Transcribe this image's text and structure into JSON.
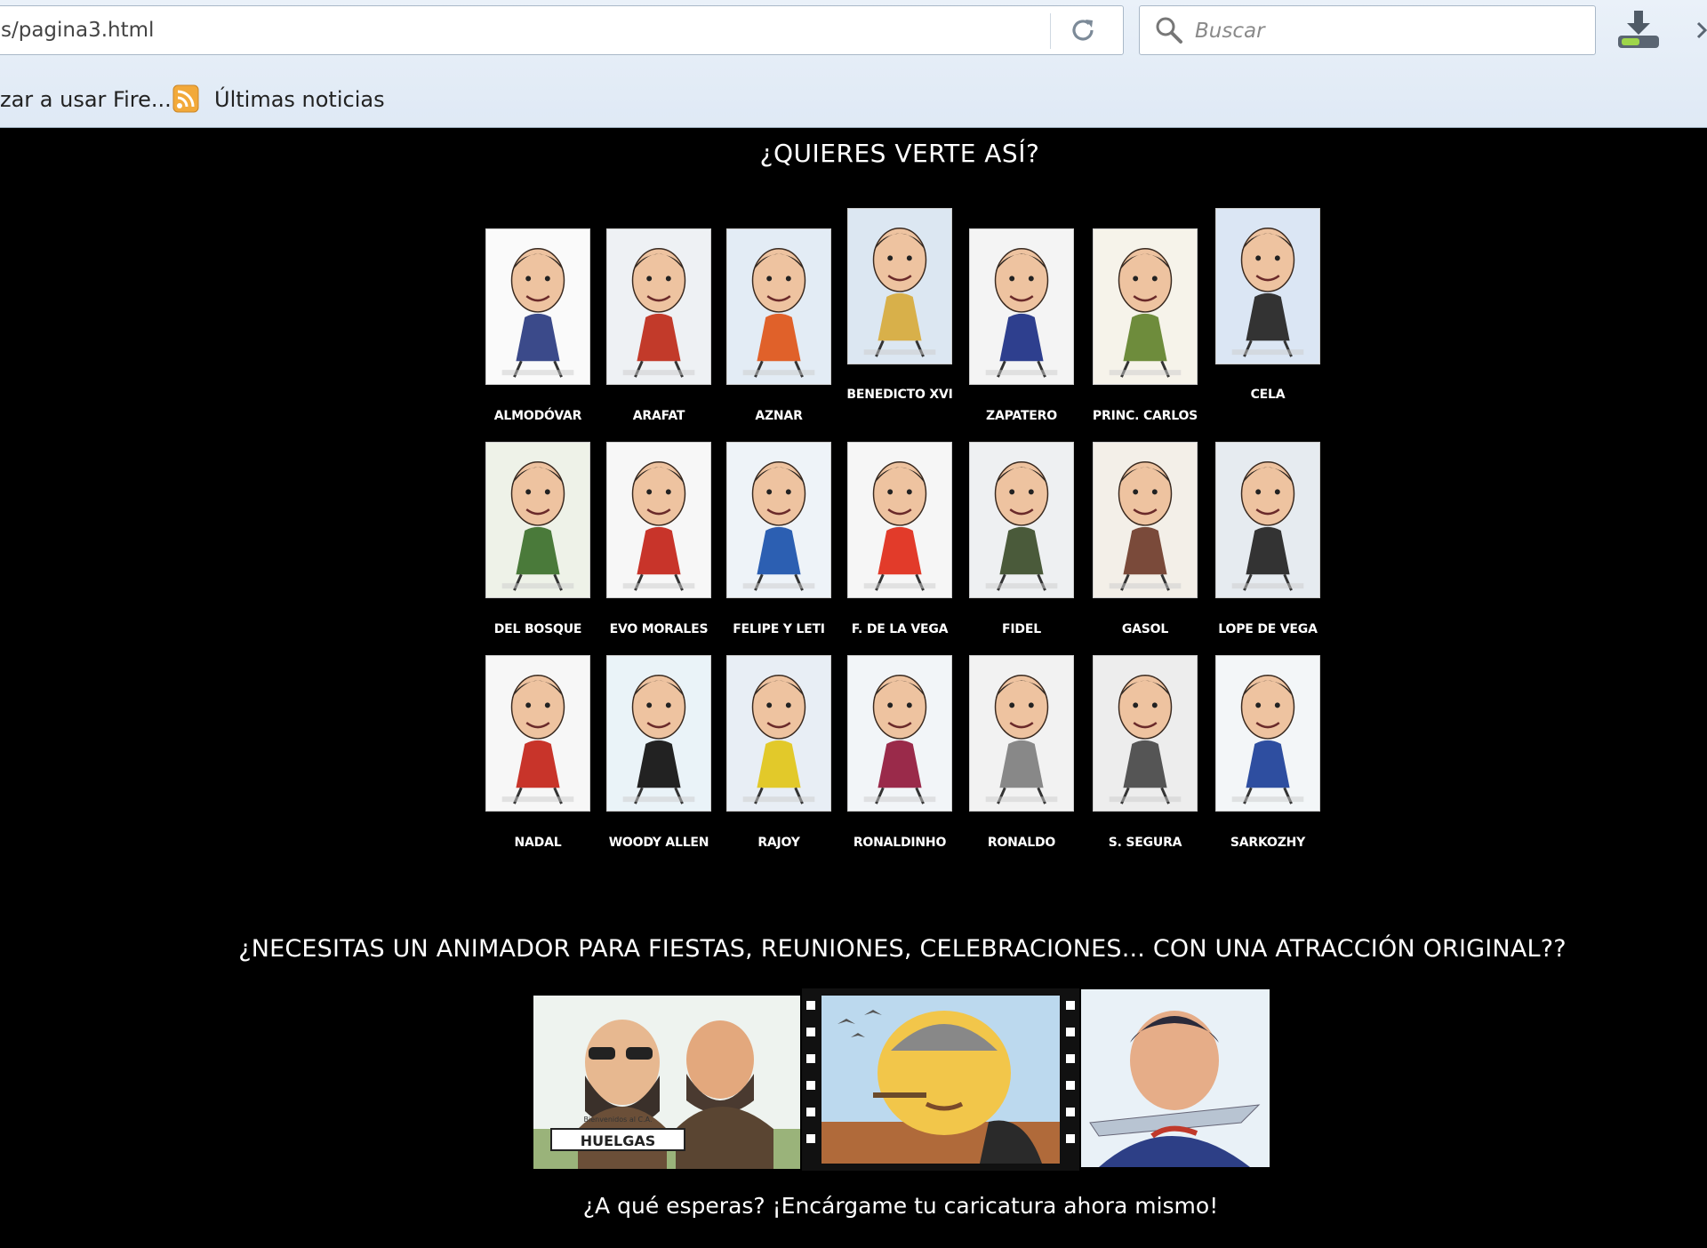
{
  "browser": {
    "url": "s/pagina3.html",
    "search_placeholder": "Buscar",
    "bookmarks": [
      {
        "label": "zar a usar Fire..."
      },
      {
        "label": "Últimas noticias"
      }
    ]
  },
  "page": {
    "heading": "¿QUIERES VERTE ASÍ?",
    "caricatures": [
      {
        "name": "ALMODÓVAR",
        "bg": "#fafafa",
        "accent": "#3b4a8a"
      },
      {
        "name": "ARAFAT",
        "bg": "#eef1f4",
        "accent": "#c23a2a"
      },
      {
        "name": "AZNAR",
        "bg": "#e3ecf5",
        "accent": "#e0612a"
      },
      {
        "name": "BENEDICTO XVI",
        "bg": "#dce7f2",
        "accent": "#d8b04a"
      },
      {
        "name": "CELA",
        "bg": "#dbe6f4",
        "accent": "#333333"
      },
      {
        "name": "ZAPATERO",
        "bg": "#f4f4f4",
        "accent": "#2e3f8e"
      },
      {
        "name": "PRINC. CARLOS",
        "bg": "#f6f3ea",
        "accent": "#6e8c3c"
      },
      {
        "name": "DEL BOSQUE",
        "bg": "#eef2e8",
        "accent": "#4a7a3a"
      },
      {
        "name": "EVO MORALES",
        "bg": "#f7f7f7",
        "accent": "#c8342a"
      },
      {
        "name": "FELIPE Y LETI",
        "bg": "#eef3f8",
        "accent": "#2c5fb2"
      },
      {
        "name": "F. DE LA VEGA",
        "bg": "#f6f6f6",
        "accent": "#e23b2a"
      },
      {
        "name": "FIDEL",
        "bg": "#eef0f2",
        "accent": "#4a5a3a"
      },
      {
        "name": "GASOL",
        "bg": "#f3efe8",
        "accent": "#7a4a3a"
      },
      {
        "name": "LOPE DE VEGA",
        "bg": "#e6ebf0",
        "accent": "#333333"
      },
      {
        "name": "NADAL",
        "bg": "#f7f7f7",
        "accent": "#c8342a"
      },
      {
        "name": "WOODY ALLEN",
        "bg": "#eaf3f8",
        "accent": "#222222"
      },
      {
        "name": "RAJOY",
        "bg": "#e8eef5",
        "accent": "#e2c92a"
      },
      {
        "name": "RONALDINHO",
        "bg": "#f2f5f8",
        "accent": "#9a2a4a"
      },
      {
        "name": "RONALDO",
        "bg": "#f2f2f2",
        "accent": "#888888"
      },
      {
        "name": "S. SEGURA",
        "bg": "#ededed",
        "accent": "#555555"
      },
      {
        "name": "SARKOZHY",
        "bg": "#f3f6f8",
        "accent": "#2e4ea0"
      }
    ],
    "promo_question": "¿NECESITAS UN ANIMADOR PARA FIESTAS, REUNIONES, CELEBRACIONES... CON UNA ATRACCIÓN ORIGINAL??",
    "banner_sign": "HUELGAS",
    "banner_sign_small": "Bienvenidos al C.A.",
    "cta": "¿A qué esperas? ¡Encárgame tu caricatura ahora mismo!"
  }
}
